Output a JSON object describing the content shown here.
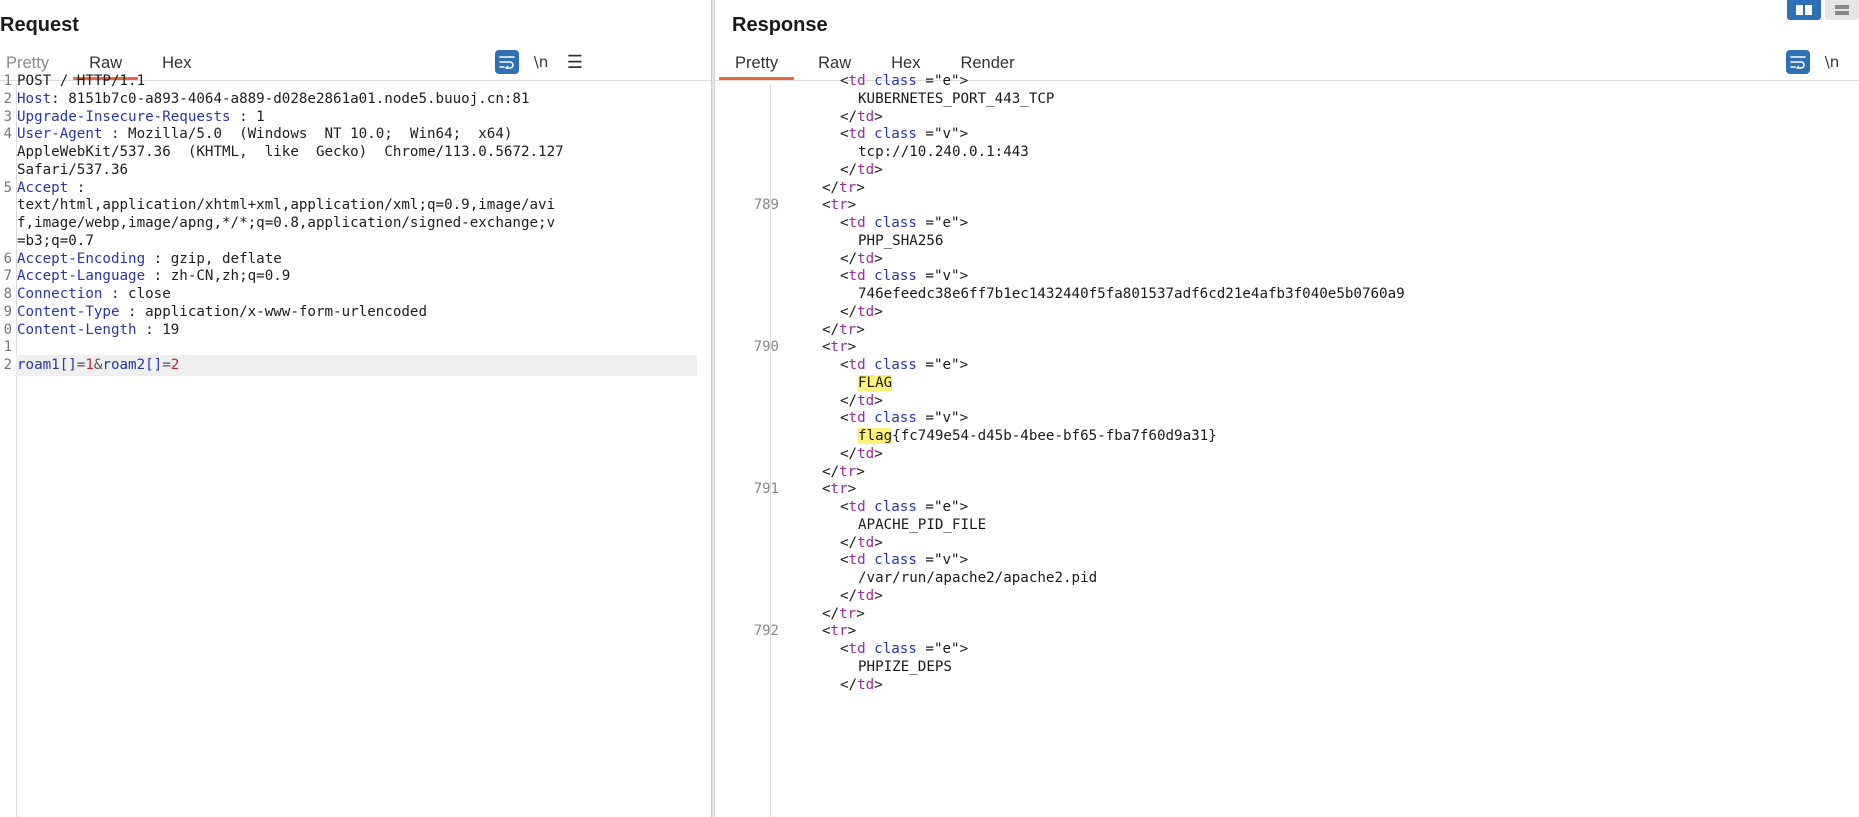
{
  "request": {
    "title": "Request",
    "tabs": [
      "Pretty",
      "Raw",
      "Hex"
    ],
    "active_tab": "Raw",
    "tools": {
      "newline": "\\n",
      "menu": "☰"
    },
    "lines": [
      {
        "n": "1",
        "parts": [
          {
            "t": "POST / HTTP/1.1",
            "c": "val"
          }
        ]
      },
      {
        "n": "2",
        "parts": [
          {
            "t": "Host",
            "c": "hdr"
          },
          {
            "t": ": 8151b7c0-a893-4064-a889-d028e2861a01.node5.buuoj.cn:81",
            "c": "val"
          }
        ]
      },
      {
        "n": "3",
        "parts": [
          {
            "t": "Upgrade-Insecure-Requests",
            "c": "hdr"
          },
          {
            "t": " : 1",
            "c": "val"
          }
        ]
      },
      {
        "n": "4",
        "parts": [
          {
            "t": "User-Agent",
            "c": "hdr"
          },
          {
            "t": " : Mozilla/5.0  (Windows  NT 10.0;  Win64;  x64)",
            "c": "val"
          }
        ]
      },
      {
        "n": "",
        "parts": [
          {
            "t": "AppleWebKit/537.36  (KHTML,  like  Gecko)  Chrome/113.0.5672.127",
            "c": "val"
          }
        ]
      },
      {
        "n": "",
        "parts": [
          {
            "t": "Safari/537.36",
            "c": "val"
          }
        ]
      },
      {
        "n": "5",
        "parts": [
          {
            "t": "Accept",
            "c": "hdr"
          },
          {
            "t": " :",
            "c": "val"
          }
        ]
      },
      {
        "n": "",
        "parts": [
          {
            "t": "text/html,application/xhtml+xml,application/xml;q=0.9,image/avi",
            "c": "val"
          }
        ]
      },
      {
        "n": "",
        "parts": [
          {
            "t": "f,image/webp,image/apng,*/*;q=0.8,application/signed-exchange;v",
            "c": "val"
          }
        ]
      },
      {
        "n": "",
        "parts": [
          {
            "t": "=b3;q=0.7",
            "c": "val"
          }
        ]
      },
      {
        "n": "6",
        "parts": [
          {
            "t": "Accept-Encoding",
            "c": "hdr"
          },
          {
            "t": " : gzip, deflate",
            "c": "val"
          }
        ]
      },
      {
        "n": "7",
        "parts": [
          {
            "t": "Accept-Language",
            "c": "hdr"
          },
          {
            "t": " : zh-CN,zh;q=0.9",
            "c": "val"
          }
        ]
      },
      {
        "n": "8",
        "parts": [
          {
            "t": "Connection",
            "c": "hdr"
          },
          {
            "t": " : close",
            "c": "val"
          }
        ]
      },
      {
        "n": "9",
        "parts": [
          {
            "t": "Content-Type",
            "c": "hdr"
          },
          {
            "t": " : application/x-www-form-urlencoded",
            "c": "val"
          }
        ]
      },
      {
        "n": "0",
        "parts": [
          {
            "t": "Content-Length",
            "c": "hdr"
          },
          {
            "t": " : 19",
            "c": "val"
          }
        ]
      },
      {
        "n": "1",
        "parts": []
      },
      {
        "n": "2",
        "current": true,
        "parts": [
          {
            "t": "roam1[]",
            "c": "pkey"
          },
          {
            "t": "=",
            "c": "peq"
          },
          {
            "t": "1",
            "c": "pval"
          },
          {
            "t": "&",
            "c": "peq"
          },
          {
            "t": "roam2[]",
            "c": "pkey"
          },
          {
            "t": "=",
            "c": "peq"
          },
          {
            "t": "2",
            "c": "pval"
          }
        ]
      }
    ]
  },
  "response": {
    "title": "Response",
    "tabs": [
      "Pretty",
      "Raw",
      "Hex",
      "Render"
    ],
    "active_tab": "Pretty",
    "tools": {
      "newline": "\\n"
    },
    "lines": [
      {
        "n": "",
        "i": 3,
        "parts": [
          {
            "t": "<",
            "c": "lt"
          },
          {
            "t": "td",
            "c": "tag"
          },
          {
            "t": " class",
            "c": "attr"
          },
          {
            "t": " =\"e\">",
            "c": "str"
          }
        ]
      },
      {
        "n": "",
        "i": 4,
        "parts": [
          {
            "t": "KUBERNETES_PORT_443_TCP",
            "c": "txt"
          }
        ]
      },
      {
        "n": "",
        "i": 3,
        "parts": [
          {
            "t": "</",
            "c": "lt"
          },
          {
            "t": "td",
            "c": "tag"
          },
          {
            "t": ">",
            "c": "lt"
          }
        ]
      },
      {
        "n": "",
        "i": 3,
        "parts": [
          {
            "t": "<",
            "c": "lt"
          },
          {
            "t": "td",
            "c": "tag"
          },
          {
            "t": " class",
            "c": "attr"
          },
          {
            "t": " =\"v\">",
            "c": "str"
          }
        ]
      },
      {
        "n": "",
        "i": 4,
        "parts": [
          {
            "t": "tcp://10.240.0.1:443",
            "c": "txt"
          }
        ]
      },
      {
        "n": "",
        "i": 3,
        "parts": [
          {
            "t": "</",
            "c": "lt"
          },
          {
            "t": "td",
            "c": "tag"
          },
          {
            "t": ">",
            "c": "lt"
          }
        ]
      },
      {
        "n": "",
        "i": 2,
        "parts": [
          {
            "t": "</",
            "c": "lt"
          },
          {
            "t": "tr",
            "c": "tag"
          },
          {
            "t": ">",
            "c": "lt"
          }
        ]
      },
      {
        "n": "789",
        "i": 2,
        "parts": [
          {
            "t": "<",
            "c": "lt"
          },
          {
            "t": "tr",
            "c": "tag"
          },
          {
            "t": ">",
            "c": "lt"
          }
        ]
      },
      {
        "n": "",
        "i": 3,
        "parts": [
          {
            "t": "<",
            "c": "lt"
          },
          {
            "t": "td",
            "c": "tag"
          },
          {
            "t": " class",
            "c": "attr"
          },
          {
            "t": " =\"e\">",
            "c": "str"
          }
        ]
      },
      {
        "n": "",
        "i": 4,
        "parts": [
          {
            "t": "PHP_SHA256",
            "c": "txt"
          }
        ]
      },
      {
        "n": "",
        "i": 3,
        "parts": [
          {
            "t": "</",
            "c": "lt"
          },
          {
            "t": "td",
            "c": "tag"
          },
          {
            "t": ">",
            "c": "lt"
          }
        ]
      },
      {
        "n": "",
        "i": 3,
        "parts": [
          {
            "t": "<",
            "c": "lt"
          },
          {
            "t": "td",
            "c": "tag"
          },
          {
            "t": " class",
            "c": "attr"
          },
          {
            "t": " =\"v\">",
            "c": "str"
          }
        ]
      },
      {
        "n": "",
        "i": 4,
        "parts": [
          {
            "t": "746efeedc38e6ff7b1ec1432440f5fa801537adf6cd21e4afb3f040e5b0760a9",
            "c": "txt"
          }
        ]
      },
      {
        "n": "",
        "i": 3,
        "parts": [
          {
            "t": "</",
            "c": "lt"
          },
          {
            "t": "td",
            "c": "tag"
          },
          {
            "t": ">",
            "c": "lt"
          }
        ]
      },
      {
        "n": "",
        "i": 2,
        "parts": [
          {
            "t": "</",
            "c": "lt"
          },
          {
            "t": "tr",
            "c": "tag"
          },
          {
            "t": ">",
            "c": "lt"
          }
        ]
      },
      {
        "n": "790",
        "i": 2,
        "parts": [
          {
            "t": "<",
            "c": "lt"
          },
          {
            "t": "tr",
            "c": "tag"
          },
          {
            "t": ">",
            "c": "lt"
          }
        ]
      },
      {
        "n": "",
        "i": 3,
        "parts": [
          {
            "t": "<",
            "c": "lt"
          },
          {
            "t": "td",
            "c": "tag"
          },
          {
            "t": " class",
            "c": "attr"
          },
          {
            "t": " =\"e\">",
            "c": "str"
          }
        ]
      },
      {
        "n": "",
        "i": 4,
        "parts": [
          {
            "t": "FLAG",
            "c": "txt hl"
          }
        ]
      },
      {
        "n": "",
        "i": 3,
        "parts": [
          {
            "t": "</",
            "c": "lt"
          },
          {
            "t": "td",
            "c": "tag"
          },
          {
            "t": ">",
            "c": "lt"
          }
        ]
      },
      {
        "n": "",
        "i": 3,
        "parts": [
          {
            "t": "<",
            "c": "lt"
          },
          {
            "t": "td",
            "c": "tag"
          },
          {
            "t": " class",
            "c": "attr"
          },
          {
            "t": " =\"v\">",
            "c": "str"
          }
        ]
      },
      {
        "n": "",
        "i": 4,
        "parts": [
          {
            "t": "flag",
            "c": "txt hl"
          },
          {
            "t": "{fc749e54-d45b-4bee-bf65-fba7f60d9a31}",
            "c": "txt"
          }
        ]
      },
      {
        "n": "",
        "i": 3,
        "parts": [
          {
            "t": "</",
            "c": "lt"
          },
          {
            "t": "td",
            "c": "tag"
          },
          {
            "t": ">",
            "c": "lt"
          }
        ]
      },
      {
        "n": "",
        "i": 2,
        "parts": [
          {
            "t": "</",
            "c": "lt"
          },
          {
            "t": "tr",
            "c": "tag"
          },
          {
            "t": ">",
            "c": "lt"
          }
        ]
      },
      {
        "n": "791",
        "i": 2,
        "parts": [
          {
            "t": "<",
            "c": "lt"
          },
          {
            "t": "tr",
            "c": "tag"
          },
          {
            "t": ">",
            "c": "lt"
          }
        ]
      },
      {
        "n": "",
        "i": 3,
        "parts": [
          {
            "t": "<",
            "c": "lt"
          },
          {
            "t": "td",
            "c": "tag"
          },
          {
            "t": " class",
            "c": "attr"
          },
          {
            "t": " =\"e\">",
            "c": "str"
          }
        ]
      },
      {
        "n": "",
        "i": 4,
        "parts": [
          {
            "t": "APACHE_PID_FILE",
            "c": "txt"
          }
        ]
      },
      {
        "n": "",
        "i": 3,
        "parts": [
          {
            "t": "</",
            "c": "lt"
          },
          {
            "t": "td",
            "c": "tag"
          },
          {
            "t": ">",
            "c": "lt"
          }
        ]
      },
      {
        "n": "",
        "i": 3,
        "parts": [
          {
            "t": "<",
            "c": "lt"
          },
          {
            "t": "td",
            "c": "tag"
          },
          {
            "t": " class",
            "c": "attr"
          },
          {
            "t": " =\"v\">",
            "c": "str"
          }
        ]
      },
      {
        "n": "",
        "i": 4,
        "parts": [
          {
            "t": "/var/run/apache2/apache2.pid",
            "c": "txt"
          }
        ]
      },
      {
        "n": "",
        "i": 3,
        "parts": [
          {
            "t": "</",
            "c": "lt"
          },
          {
            "t": "td",
            "c": "tag"
          },
          {
            "t": ">",
            "c": "lt"
          }
        ]
      },
      {
        "n": "",
        "i": 2,
        "parts": [
          {
            "t": "</",
            "c": "lt"
          },
          {
            "t": "tr",
            "c": "tag"
          },
          {
            "t": ">",
            "c": "lt"
          }
        ]
      },
      {
        "n": "792",
        "i": 2,
        "parts": [
          {
            "t": "<",
            "c": "lt"
          },
          {
            "t": "tr",
            "c": "tag"
          },
          {
            "t": ">",
            "c": "lt"
          }
        ]
      },
      {
        "n": "",
        "i": 3,
        "parts": [
          {
            "t": "<",
            "c": "lt"
          },
          {
            "t": "td",
            "c": "tag"
          },
          {
            "t": " class",
            "c": "attr"
          },
          {
            "t": " =\"e\">",
            "c": "str"
          }
        ]
      },
      {
        "n": "",
        "i": 4,
        "parts": [
          {
            "t": "PHPIZE_DEPS",
            "c": "txt"
          }
        ]
      },
      {
        "n": "",
        "i": 3,
        "parts": [
          {
            "t": "</",
            "c": "lt"
          },
          {
            "t": "td",
            "c": "tag"
          },
          {
            "t": ">",
            "c": "lt"
          }
        ]
      }
    ]
  },
  "layout_toggle": {
    "options": [
      "split-view",
      "stacked-view"
    ],
    "active": "split-view"
  },
  "colors": {
    "accent_tab": "#e8683e",
    "button_blue": "#2f6fb6",
    "tag_purple": "#9c2aa0",
    "header_blue": "#2837a6",
    "highlight": "#fff176"
  }
}
